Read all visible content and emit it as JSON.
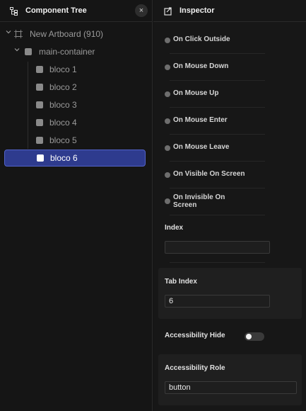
{
  "component_tree": {
    "title": "Component Tree",
    "close_label": "×",
    "artboard": "New Artboard (910)",
    "container": "main-container",
    "blocks": [
      "bloco 1",
      "bloco 2",
      "bloco 3",
      "bloco 4",
      "bloco 5",
      "bloco 6"
    ],
    "selected_block": "bloco 6"
  },
  "inspector": {
    "title": "Inspector",
    "events": [
      "On Click Outside",
      "On Mouse Down",
      "On Mouse Up",
      "On Mouse Enter",
      "On Mouse Leave",
      "On Visible On Screen",
      "On Invisible On Screen"
    ],
    "index": {
      "label": "Index",
      "value": ""
    },
    "tab_index": {
      "label": "Tab Index",
      "value": "6"
    },
    "accessibility_hide": {
      "label": "Accessibility Hide",
      "enabled": false
    },
    "accessibility_role": {
      "label": "Accessibility Role",
      "value": "button"
    }
  },
  "colors": {
    "selection": "#2e3b8e",
    "selection_border": "#5263c9",
    "background": "#141414"
  }
}
